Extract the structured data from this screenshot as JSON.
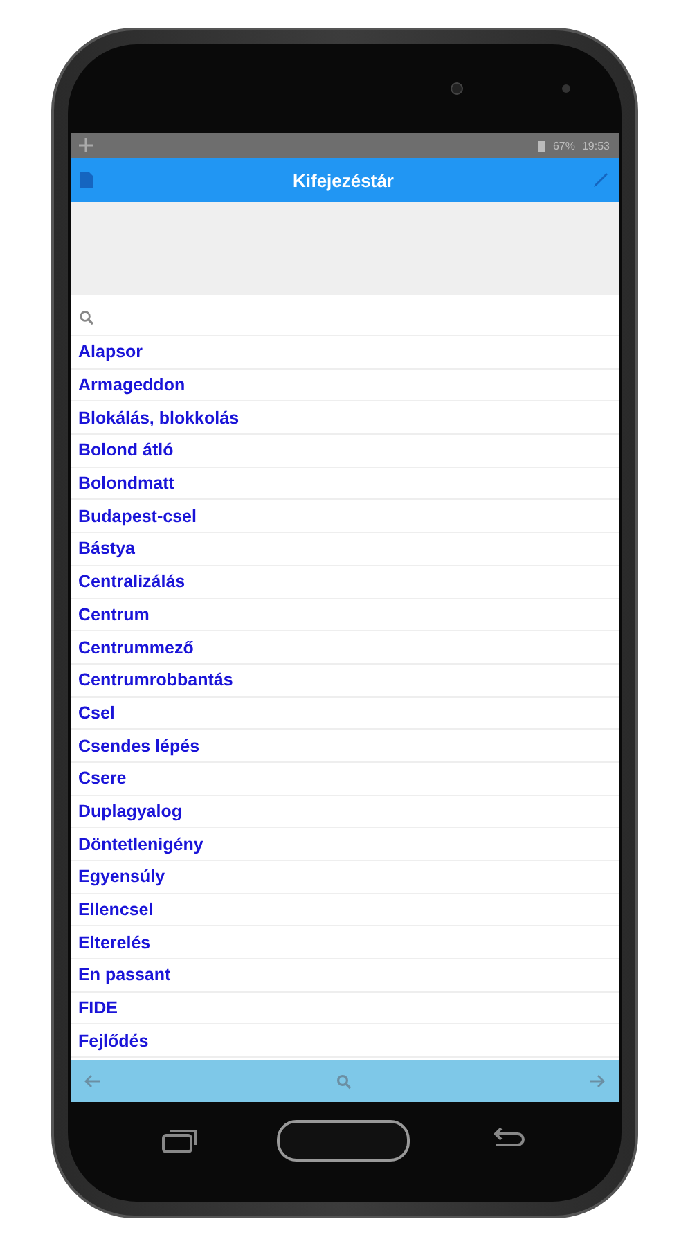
{
  "status_bar": {
    "battery": "67%",
    "time": "19:53"
  },
  "app_bar": {
    "title": "Kifejezéstár"
  },
  "terms": [
    "Alapsor",
    "Armageddon",
    "Blokálás, blokkolás",
    "Bolond átló",
    "Bolondmatt",
    "Budapest-csel",
    "Bástya",
    "Centralizálás",
    "Centrum",
    "Centrummező",
    "Centrumrobbantás",
    "Csel",
    "Csendes lépés",
    "Csere",
    "Duplagyalog",
    "Döntetlenigény",
    "Egyensúly",
    "Ellencsel",
    "Elterelés",
    "En passant",
    "FIDE",
    "Fejlődés"
  ]
}
